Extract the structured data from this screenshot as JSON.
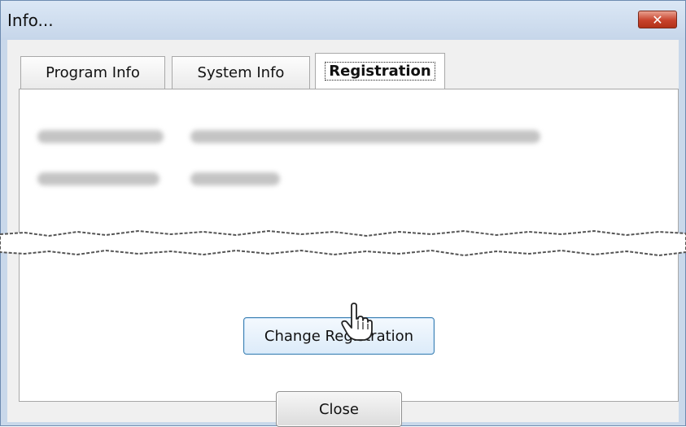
{
  "window": {
    "title": "Info...",
    "close_glyph": "✕"
  },
  "tabs": [
    {
      "label": "Program Info",
      "active": false
    },
    {
      "label": "System Info",
      "active": false
    },
    {
      "label": "Registration",
      "active": true
    }
  ],
  "registration": {
    "change_button_label": "Change Registration"
  },
  "footer": {
    "close_label": "Close"
  },
  "icons": {
    "cursor": "hand-pointer-icon",
    "close": "close-icon"
  }
}
